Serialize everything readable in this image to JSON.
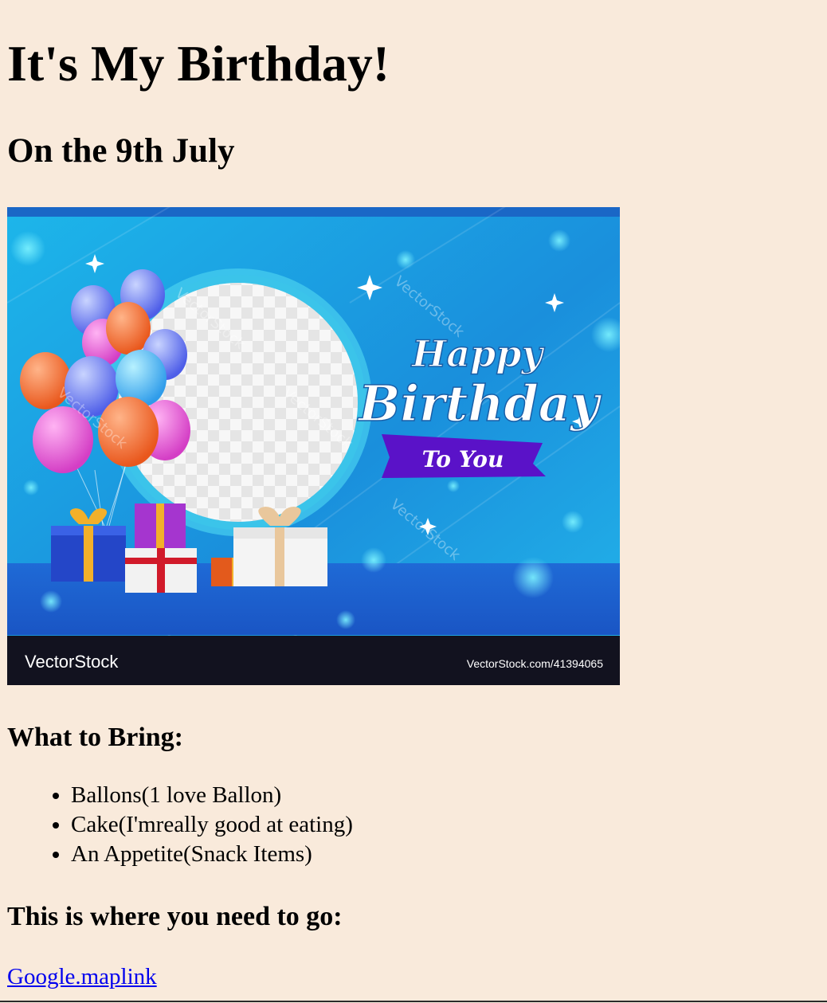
{
  "title": "It's My Birthday!",
  "date_line": "On the 9th July",
  "image": {
    "alt": "Happy Birthday To You",
    "greeting_line1": "Happy",
    "greeting_line2": "Birthday",
    "ribbon_text": "To You",
    "watermark": "VectorStock",
    "brand_logo": "VectorStock",
    "brand_url": "VectorStock.com/41394065",
    "colors": {
      "background": "#1ea6e6",
      "ribbon": "#5a12c8",
      "footer": "#12121f"
    }
  },
  "bring_heading": "What to Bring:",
  "bring_items": [
    "Ballons(1 love Ballon)",
    "Cake(I'mreally good at eating)",
    "An Appetite(Snack Items)"
  ],
  "go_heading": "This is where you need to go:",
  "map_link": {
    "label": "Google.maplink",
    "color": "#0000ee"
  }
}
